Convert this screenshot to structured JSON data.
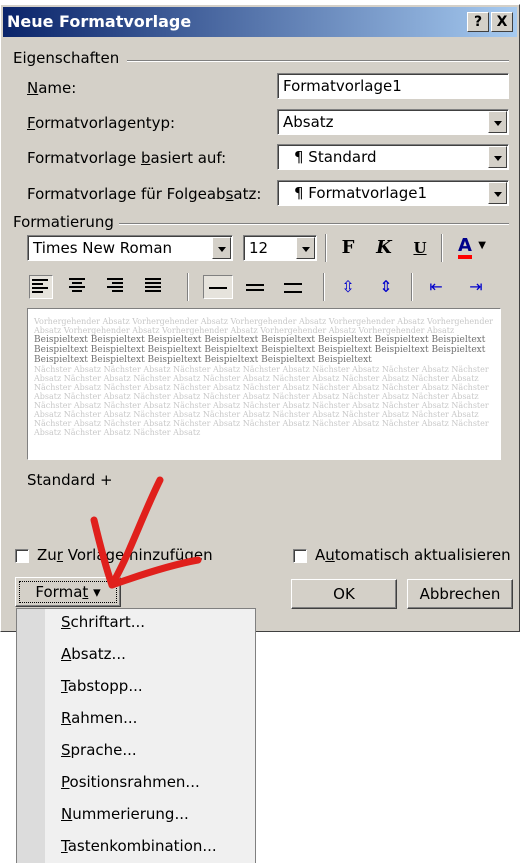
{
  "dialog": {
    "title": "Neue Formatvorlage",
    "help_btn": "?",
    "close_btn": "X"
  },
  "eigenschaften": {
    "group_title": "Eigenschaften",
    "name_label_u": "N",
    "name_label_rest": "ame:",
    "name_value": "Formatvorlage1",
    "typ_label_u": "F",
    "typ_label_rest": "ormatvorlagentyp:",
    "typ_value": "Absatz",
    "basiert_label_pre": "Formatvorlage ",
    "basiert_label_u": "b",
    "basiert_label_post": "asiert auf:",
    "basiert_value": "¶ Standard",
    "folge_label_pre": "Formatvorlage für Folgeab",
    "folge_label_u": "s",
    "folge_label_post": "atz:",
    "folge_value": "¶ Formatvorlage1"
  },
  "formatierung": {
    "group_title": "Formatierung",
    "font_value": "Times New Roman",
    "size_value": "12",
    "bold": "F",
    "italic": "K",
    "underline": "U",
    "color_letter": "A"
  },
  "preview": {
    "light_top": "Vorhergehender Absatz Vorhergehender Absatz Vorhergehender Absatz Vorhergehender Absatz Vorhergehender Absatz Vorhergehender Absatz Vorhergehender Absatz Vorhergehender Absatz Vorhergehender Absatz",
    "dark": "Beispieltext Beispieltext Beispieltext Beispieltext Beispieltext Beispieltext Beispieltext Beispieltext Beispieltext Beispieltext Beispieltext Beispieltext Beispieltext Beispieltext Beispieltext Beispieltext Beispieltext Beispieltext Beispieltext Beispieltext Beispieltext Beispieltext",
    "light_bottom": "Nächster Absatz Nächster Absatz Nächster Absatz Nächster Absatz Nächster Absatz Nächster Absatz Nächster Absatz Nächster Absatz Nächster Absatz Nächster Absatz Nächster Absatz Nächster Absatz Nächster Absatz Nächster Absatz Nächster Absatz Nächster Absatz Nächster Absatz Nächster Absatz Nächster Absatz Nächster Absatz Nächster Absatz Nächster Absatz Nächster Absatz Nächster Absatz Nächster Absatz Nächster Absatz Nächster Absatz Nächster Absatz Nächster Absatz Nächster Absatz Nächster Absatz Nächster Absatz Nächster Absatz Nächster Absatz Nächster Absatz Nächster Absatz Nächster Absatz Nächster Absatz Nächster Absatz Nächster Absatz Nächster Absatz Nächster Absatz Nächster Absatz Nächster Absatz Nächster Absatz Nächster Absatz Nächster Absatz Nächster Absatz"
  },
  "description": "Standard +",
  "footer": {
    "vorlage_pre": "Zu",
    "vorlage_u": "r",
    "vorlage_post": " Vorlage hinzufügen",
    "auto_pre": "A",
    "auto_u": "u",
    "auto_post": "tomatisch aktualisieren",
    "format_pre": "Forma",
    "format_u": "t",
    "format_arrow": "▾",
    "ok": "OK",
    "cancel": "Abbrechen"
  },
  "menu": {
    "items": [
      {
        "u": "S",
        "rest": "chriftart..."
      },
      {
        "u": "A",
        "rest": "bsatz..."
      },
      {
        "u": "T",
        "rest": "abstopp..."
      },
      {
        "u": "R",
        "rest": "ahmen..."
      },
      {
        "u": "S",
        "rest": "prache..."
      },
      {
        "u": "P",
        "rest": "ositionsrahmen..."
      },
      {
        "u": "N",
        "rest": "ummerierung..."
      },
      {
        "u": "T",
        "rest": "astenkombination..."
      }
    ]
  },
  "colors": {
    "titlebar_start": "#0a246a",
    "titlebar_end": "#a6caf0",
    "dialog_bg": "#d4d0c8",
    "annotation_arrow": "#e0201c",
    "font_color_bar": "#ff0000"
  }
}
